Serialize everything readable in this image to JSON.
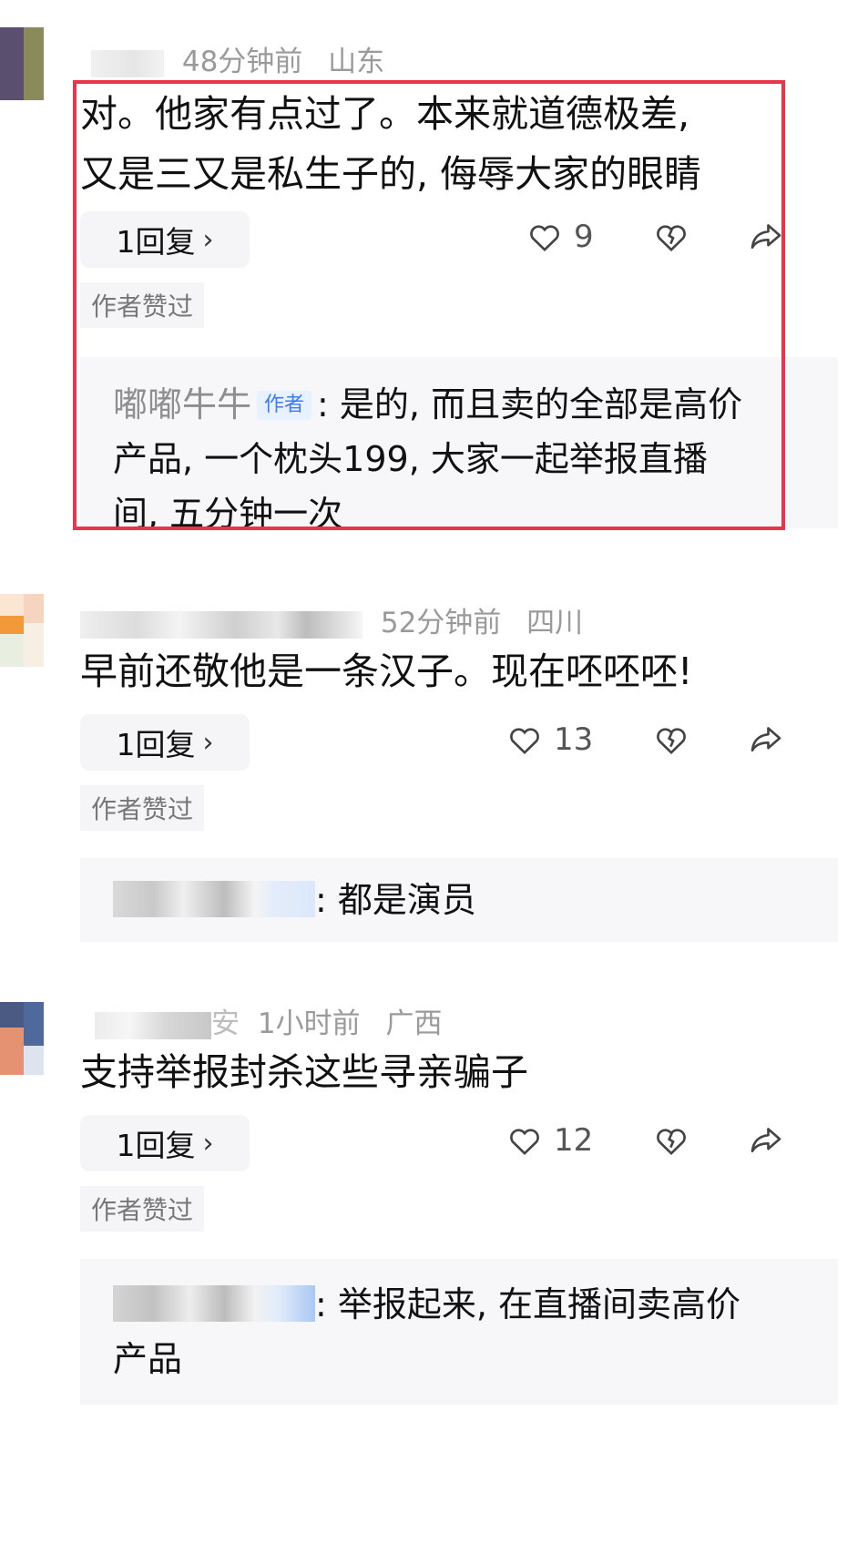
{
  "comments": [
    {
      "time": "48分钟前",
      "location": "山东",
      "lines": [
        "对。他家有点过了。本来就道德极差,",
        "又是三又是私生子的, 侮辱大家的眼睛"
      ],
      "reply_count": "1回复",
      "likes": "9",
      "liked_by_author": "作者赞过",
      "reply": {
        "user": "嘟嘟牛牛",
        "badge": "作者",
        "lines": [
          ": 是的, 而且卖的全部是高价",
          "产品, 一个枕头199, 大家一起举报直播",
          "间, 五分钟一次"
        ]
      }
    },
    {
      "time": "52分钟前",
      "location": "四川",
      "lines": [
        "早前还敬他是一条汉子。现在呸呸呸!"
      ],
      "reply_count": "1回复",
      "likes": "13",
      "liked_by_author": "作者赞过",
      "reply": {
        "lines": [
          ": 都是演员"
        ]
      }
    },
    {
      "time": "1小时前",
      "location": "广西",
      "username_fragment": "安",
      "lines": [
        "支持举报封杀这些寻亲骗子"
      ],
      "reply_count": "1回复",
      "likes": "12",
      "liked_by_author": "作者赞过",
      "reply": {
        "lines": [
          ": 举报起来, 在直播间卖高价",
          "产品"
        ]
      }
    }
  ],
  "icons": {
    "like": "heart-icon",
    "dislike": "broken-heart-icon",
    "share": "share-arrow-icon",
    "chevron": "chevron-right-icon"
  },
  "colors": {
    "highlight_border": "#e8354a",
    "author_badge_text": "#3b7cf5",
    "author_badge_bg": "#e8f1ff"
  }
}
